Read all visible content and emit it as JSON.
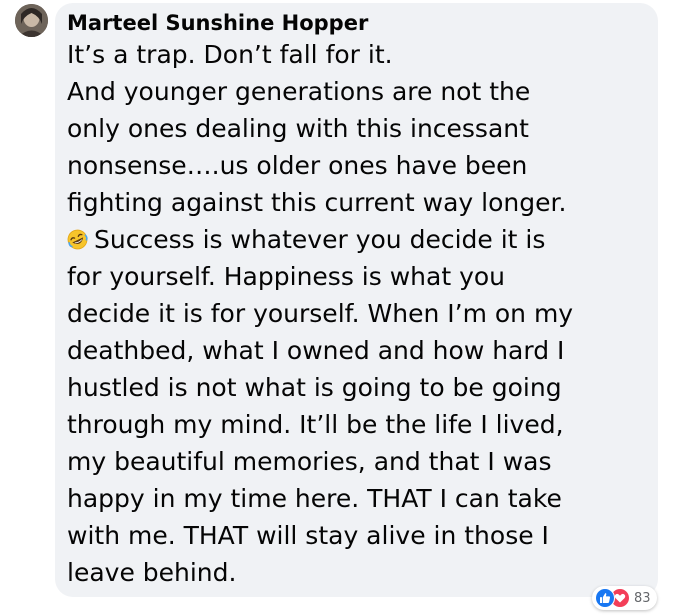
{
  "comment": {
    "author": "Marteel Sunshine Hopper",
    "lines": [
      "It’s a trap. Don’t fall for it.",
      "And younger generations are not the",
      "only ones dealing with this incessant",
      "nonsense….us older ones have been",
      "fighting against this current way longer.",
      "Success is whatever you decide it is",
      "for yourself. Happiness is what you",
      "decide it is for yourself. When I’m on my",
      "deathbed, what I owned and how hard I",
      "hustled is not what is going to be going",
      "through my mind. It’ll be the life I lived,",
      "my beautiful memories, and that I was",
      "happy in my time here. THAT I can take",
      "with me. THAT will stay alive in those I",
      "leave behind."
    ],
    "emoji_icon": "rofl-emoji-icon"
  },
  "reactions": {
    "icons": [
      "like-icon",
      "love-icon"
    ],
    "count": "83"
  },
  "colors": {
    "bubble_bg": "#f0f2f5",
    "text": "#050505",
    "like_blue": "#1877f2",
    "love_red": "#f33e58",
    "count_gray": "#65676b"
  }
}
